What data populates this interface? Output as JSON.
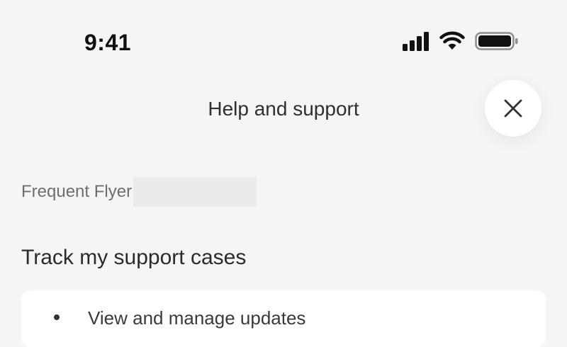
{
  "status_bar": {
    "time": "9:41",
    "icons": [
      "cellular-signal-icon",
      "wifi-icon",
      "battery-icon"
    ]
  },
  "header": {
    "title": "Help and support",
    "close_icon": "close-icon"
  },
  "frequent_flyer": {
    "label": "Frequent Flyer"
  },
  "support_cases": {
    "heading": "Track my support cases",
    "card": {
      "label": "View and manage updates",
      "icon": "bullet-icon"
    }
  },
  "colors": {
    "background": "#f5f5f5",
    "surface": "#ffffff",
    "text_primary": "#2b2b2b",
    "text_secondary": "#6e6e6e"
  }
}
